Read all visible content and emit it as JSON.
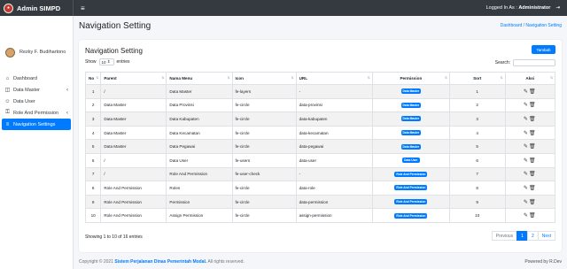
{
  "app": {
    "name": "Admin SIMPD",
    "menu_icon": "≡"
  },
  "topbar": {
    "logged_prefix": "Logged In As :",
    "logged_user": "Administrator",
    "logout_icon": "⇥"
  },
  "sidebar": {
    "user_name": "Rezky F. Budihartono",
    "items": [
      {
        "icon": "⌂",
        "label": "Dashboard",
        "chev": ""
      },
      {
        "icon": "◫",
        "label": "Data Master",
        "chev": "‹"
      },
      {
        "icon": "☺",
        "label": "Data User",
        "chev": ""
      },
      {
        "icon": "⚿",
        "label": "Role And Permission",
        "chev": "‹"
      },
      {
        "icon": "≡",
        "label": "Navigation Settings",
        "chev": ""
      }
    ]
  },
  "page": {
    "title": "Navigation Setting",
    "crumb_home": "Dashboard",
    "crumb_sep": "/",
    "crumb_current": "Navigation Setting"
  },
  "card": {
    "title": "Navigation Setting",
    "add_label": "Tambah",
    "show_prefix": "Show",
    "show_value": "10",
    "show_suffix": "entries",
    "search_label": "Search:",
    "columns": [
      "No",
      "Parent",
      "Nama Menu",
      "Icon",
      "URL",
      "Permission",
      "Sort",
      "Aksi"
    ],
    "rows": [
      [
        "1",
        "/",
        "Data Master",
        "fe-layers",
        "-",
        "Data Master",
        "1"
      ],
      [
        "2",
        "Data Master",
        "Data Provinsi",
        "fe-circle",
        "data-provinsi",
        "Data Master",
        "2"
      ],
      [
        "3",
        "Data Master",
        "Data Kabupaten",
        "fe-circle",
        "data-kabupaten",
        "Data Master",
        "3"
      ],
      [
        "4",
        "Data Master",
        "Data Kecamatan",
        "fe-circle",
        "data-kecamatan",
        "Data Master",
        "4"
      ],
      [
        "5",
        "Data Master",
        "Data Pegawai",
        "fe-circle",
        "data-pegawai",
        "Data Master",
        "5"
      ],
      [
        "6",
        "/",
        "Data User",
        "fe-users",
        "data-user",
        "Data User",
        "6"
      ],
      [
        "7",
        "/",
        "Role And Permission",
        "fe-user-check",
        "-",
        "Role And Permission",
        "7"
      ],
      [
        "8",
        "Role And Permission",
        "Roles",
        "fe-circle",
        "data-role",
        "Role And Permission",
        "8"
      ],
      [
        "9",
        "Role And Permission",
        "Permission",
        "fe-circle",
        "data-permission",
        "Role And Permission",
        "9"
      ],
      [
        "10",
        "Role And Permission",
        "Assign Permission",
        "fe-circle",
        "assign-permission",
        "Role And Permission",
        "10"
      ]
    ],
    "info": "Showing 1 to 10 of 16 entries",
    "pager": {
      "prev": "Previous",
      "pages": [
        "1",
        "2"
      ],
      "next": "Next"
    },
    "aksi_icons": "✎🗑"
  },
  "footer": {
    "copy": "Copyright © 2021",
    "link": "Sistem Perjalanan Dinas Pemerintah Modal.",
    "rights": "All rights reserved.",
    "powered": "Powered by R.Dev"
  },
  "colors": {
    "primary": "#007bff",
    "topbar": "#343a40"
  }
}
